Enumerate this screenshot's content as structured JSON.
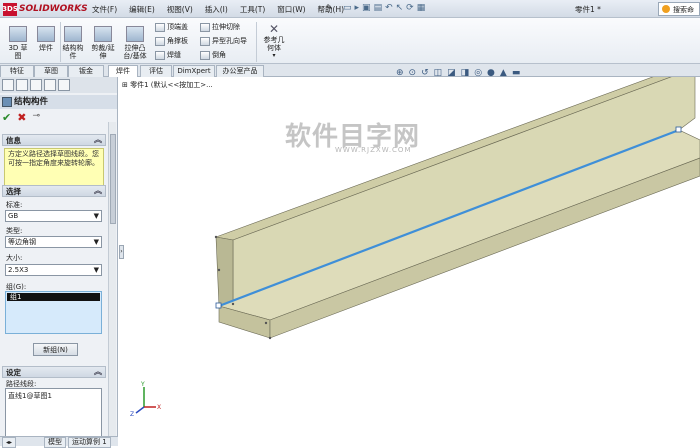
{
  "app": {
    "logo_text": "SOLIDWORKS",
    "brand_mark": "3DS",
    "doc_title": "零件1 *",
    "search_placeholder": "搜索命"
  },
  "menu": [
    "文件(F)",
    "编辑(E)",
    "视图(V)",
    "插入(I)",
    "工具(T)",
    "窗口(W)",
    "帮助(H)"
  ],
  "ribbon": {
    "big": [
      {
        "label": "3D 草图"
      },
      {
        "label": "焊件"
      },
      {
        "label": "结构构件"
      },
      {
        "label": "剪裁/延伸"
      },
      {
        "label": "拉伸凸台/基体"
      }
    ],
    "small_col1": [
      "顶端盖",
      "角撑板",
      "焊缝"
    ],
    "small_col2": [
      "拉伸切除",
      "异型孔向导",
      "倒角"
    ],
    "ref": "参考几何体"
  },
  "tabs": [
    "特征",
    "草图",
    "钣金",
    "焊件",
    "评估",
    "DimXpert",
    "办公室产品"
  ],
  "active_tab": "焊件",
  "panel": {
    "title": "结构构件",
    "info_header": "信息",
    "info_text": "方定义路径选择草图线段。您可按一指定角度来旋转轮廓。",
    "select_header": "选择",
    "standard_label": "标准:",
    "standard_value": "GB",
    "type_label": "类型:",
    "type_value": "等边角钢",
    "size_label": "大小:",
    "size_value": "2.5X3",
    "group_label": "组(G):",
    "group_item": "组1",
    "new_group": "新组(N)",
    "settings_header": "设定",
    "path_label": "路径线段:",
    "path_value": "直线1@草图1"
  },
  "tree_item": "零件1 (默认<<按加工>...",
  "bottom_tabs": [
    "模型",
    "运动算例 1"
  ],
  "watermark": {
    "main": "软件目字网",
    "sub": "WWW.RJZXW.COM"
  },
  "triad": {
    "x": "X",
    "y": "Y",
    "z": "Z"
  },
  "colors": {
    "part": "#d9d8b4",
    "edge_highlight": "#3f8fd8",
    "brand": "#c8102e"
  }
}
